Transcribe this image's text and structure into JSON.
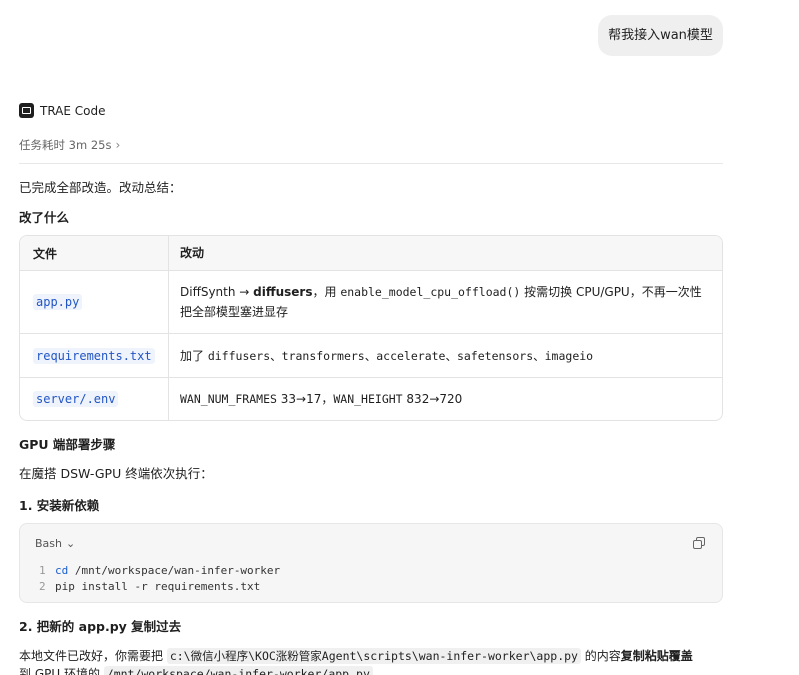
{
  "user_message": "帮我接入wan模型",
  "agent": {
    "name": "TRAE Code",
    "logo_icon": "trae-logo-icon"
  },
  "task_duration": {
    "label": "任务耗时 3m 25s",
    "chevron": "›"
  },
  "summary_intro": "已完成全部改造。改动总结：",
  "changes_heading": "改了什么",
  "changes_table": {
    "headers": [
      "文件",
      "改动"
    ],
    "rows": [
      {
        "file": "app.py",
        "change_prefix": "DiffSynth → ",
        "change_bold": "diffusers",
        "change_mid": "，用 ",
        "change_code": "enable_model_cpu_offload()",
        "change_suffix": " 按需切换 CPU/GPU，不再一次性把全部模型塞进显存"
      },
      {
        "file": "requirements.txt",
        "change_prefix": "加了 ",
        "change_code": "diffusers、transformers、accelerate、safetensors、imageio"
      },
      {
        "file": "server/.env",
        "change_code1": "WAN_NUM_FRAMES",
        "change_mid": " 33→17，",
        "change_code2": "WAN_HEIGHT",
        "change_suffix": " 832→720"
      }
    ]
  },
  "deploy_heading": "GPU 端部署步骤",
  "deploy_intro": "在魔搭 DSW-GPU 终端依次执行：",
  "step1_heading": "1. 安装新依赖",
  "codeblock": {
    "language": "Bash",
    "chevron": "⌄",
    "copy_icon": "copy-icon",
    "lines": [
      {
        "num": "1",
        "keyword": "cd",
        "rest": " /mnt/workspace/wan-infer-worker"
      },
      {
        "num": "2",
        "keyword": "",
        "rest": "pip install -r requirements.txt"
      }
    ]
  },
  "step2_heading": "2. 把新的 app.py 复制过去",
  "step2_text": {
    "prefix": "本地文件已改好，你需要把 ",
    "path1": "c:\\微信小程序\\KOC涨粉管家Agent\\scripts\\wan-infer-worker\\app.py",
    "mid": " 的内容",
    "bold": "复制粘贴覆盖",
    "line2_prefix": "到 GPU 环境的 ",
    "path2": "/mnt/workspace/wan-infer-worker/app.py"
  }
}
